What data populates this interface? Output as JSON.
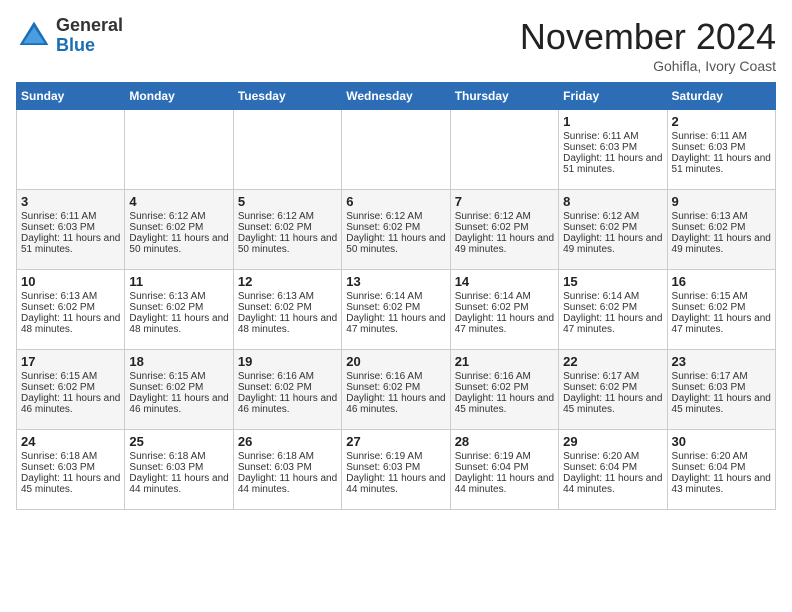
{
  "header": {
    "logo_general": "General",
    "logo_blue": "Blue",
    "month_title": "November 2024",
    "subtitle": "Gohifla, Ivory Coast"
  },
  "days_of_week": [
    "Sunday",
    "Monday",
    "Tuesday",
    "Wednesday",
    "Thursday",
    "Friday",
    "Saturday"
  ],
  "weeks": [
    [
      {
        "day": "",
        "sunrise": "",
        "sunset": "",
        "daylight": ""
      },
      {
        "day": "",
        "sunrise": "",
        "sunset": "",
        "daylight": ""
      },
      {
        "day": "",
        "sunrise": "",
        "sunset": "",
        "daylight": ""
      },
      {
        "day": "",
        "sunrise": "",
        "sunset": "",
        "daylight": ""
      },
      {
        "day": "",
        "sunrise": "",
        "sunset": "",
        "daylight": ""
      },
      {
        "day": "1",
        "sunrise": "Sunrise: 6:11 AM",
        "sunset": "Sunset: 6:03 PM",
        "daylight": "Daylight: 11 hours and 51 minutes."
      },
      {
        "day": "2",
        "sunrise": "Sunrise: 6:11 AM",
        "sunset": "Sunset: 6:03 PM",
        "daylight": "Daylight: 11 hours and 51 minutes."
      }
    ],
    [
      {
        "day": "3",
        "sunrise": "Sunrise: 6:11 AM",
        "sunset": "Sunset: 6:03 PM",
        "daylight": "Daylight: 11 hours and 51 minutes."
      },
      {
        "day": "4",
        "sunrise": "Sunrise: 6:12 AM",
        "sunset": "Sunset: 6:02 PM",
        "daylight": "Daylight: 11 hours and 50 minutes."
      },
      {
        "day": "5",
        "sunrise": "Sunrise: 6:12 AM",
        "sunset": "Sunset: 6:02 PM",
        "daylight": "Daylight: 11 hours and 50 minutes."
      },
      {
        "day": "6",
        "sunrise": "Sunrise: 6:12 AM",
        "sunset": "Sunset: 6:02 PM",
        "daylight": "Daylight: 11 hours and 50 minutes."
      },
      {
        "day": "7",
        "sunrise": "Sunrise: 6:12 AM",
        "sunset": "Sunset: 6:02 PM",
        "daylight": "Daylight: 11 hours and 49 minutes."
      },
      {
        "day": "8",
        "sunrise": "Sunrise: 6:12 AM",
        "sunset": "Sunset: 6:02 PM",
        "daylight": "Daylight: 11 hours and 49 minutes."
      },
      {
        "day": "9",
        "sunrise": "Sunrise: 6:13 AM",
        "sunset": "Sunset: 6:02 PM",
        "daylight": "Daylight: 11 hours and 49 minutes."
      }
    ],
    [
      {
        "day": "10",
        "sunrise": "Sunrise: 6:13 AM",
        "sunset": "Sunset: 6:02 PM",
        "daylight": "Daylight: 11 hours and 48 minutes."
      },
      {
        "day": "11",
        "sunrise": "Sunrise: 6:13 AM",
        "sunset": "Sunset: 6:02 PM",
        "daylight": "Daylight: 11 hours and 48 minutes."
      },
      {
        "day": "12",
        "sunrise": "Sunrise: 6:13 AM",
        "sunset": "Sunset: 6:02 PM",
        "daylight": "Daylight: 11 hours and 48 minutes."
      },
      {
        "day": "13",
        "sunrise": "Sunrise: 6:14 AM",
        "sunset": "Sunset: 6:02 PM",
        "daylight": "Daylight: 11 hours and 47 minutes."
      },
      {
        "day": "14",
        "sunrise": "Sunrise: 6:14 AM",
        "sunset": "Sunset: 6:02 PM",
        "daylight": "Daylight: 11 hours and 47 minutes."
      },
      {
        "day": "15",
        "sunrise": "Sunrise: 6:14 AM",
        "sunset": "Sunset: 6:02 PM",
        "daylight": "Daylight: 11 hours and 47 minutes."
      },
      {
        "day": "16",
        "sunrise": "Sunrise: 6:15 AM",
        "sunset": "Sunset: 6:02 PM",
        "daylight": "Daylight: 11 hours and 47 minutes."
      }
    ],
    [
      {
        "day": "17",
        "sunrise": "Sunrise: 6:15 AM",
        "sunset": "Sunset: 6:02 PM",
        "daylight": "Daylight: 11 hours and 46 minutes."
      },
      {
        "day": "18",
        "sunrise": "Sunrise: 6:15 AM",
        "sunset": "Sunset: 6:02 PM",
        "daylight": "Daylight: 11 hours and 46 minutes."
      },
      {
        "day": "19",
        "sunrise": "Sunrise: 6:16 AM",
        "sunset": "Sunset: 6:02 PM",
        "daylight": "Daylight: 11 hours and 46 minutes."
      },
      {
        "day": "20",
        "sunrise": "Sunrise: 6:16 AM",
        "sunset": "Sunset: 6:02 PM",
        "daylight": "Daylight: 11 hours and 46 minutes."
      },
      {
        "day": "21",
        "sunrise": "Sunrise: 6:16 AM",
        "sunset": "Sunset: 6:02 PM",
        "daylight": "Daylight: 11 hours and 45 minutes."
      },
      {
        "day": "22",
        "sunrise": "Sunrise: 6:17 AM",
        "sunset": "Sunset: 6:02 PM",
        "daylight": "Daylight: 11 hours and 45 minutes."
      },
      {
        "day": "23",
        "sunrise": "Sunrise: 6:17 AM",
        "sunset": "Sunset: 6:03 PM",
        "daylight": "Daylight: 11 hours and 45 minutes."
      }
    ],
    [
      {
        "day": "24",
        "sunrise": "Sunrise: 6:18 AM",
        "sunset": "Sunset: 6:03 PM",
        "daylight": "Daylight: 11 hours and 45 minutes."
      },
      {
        "day": "25",
        "sunrise": "Sunrise: 6:18 AM",
        "sunset": "Sunset: 6:03 PM",
        "daylight": "Daylight: 11 hours and 44 minutes."
      },
      {
        "day": "26",
        "sunrise": "Sunrise: 6:18 AM",
        "sunset": "Sunset: 6:03 PM",
        "daylight": "Daylight: 11 hours and 44 minutes."
      },
      {
        "day": "27",
        "sunrise": "Sunrise: 6:19 AM",
        "sunset": "Sunset: 6:03 PM",
        "daylight": "Daylight: 11 hours and 44 minutes."
      },
      {
        "day": "28",
        "sunrise": "Sunrise: 6:19 AM",
        "sunset": "Sunset: 6:04 PM",
        "daylight": "Daylight: 11 hours and 44 minutes."
      },
      {
        "day": "29",
        "sunrise": "Sunrise: 6:20 AM",
        "sunset": "Sunset: 6:04 PM",
        "daylight": "Daylight: 11 hours and 44 minutes."
      },
      {
        "day": "30",
        "sunrise": "Sunrise: 6:20 AM",
        "sunset": "Sunset: 6:04 PM",
        "daylight": "Daylight: 11 hours and 43 minutes."
      }
    ]
  ]
}
